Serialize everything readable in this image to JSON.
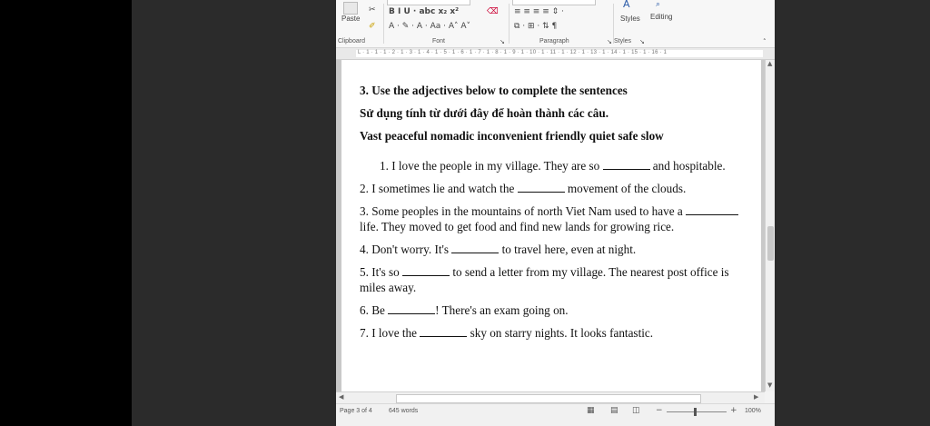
{
  "ribbon": {
    "paste_label": "Paste",
    "styles_label": "Styles",
    "editing_label": "Editing",
    "groups": {
      "clipboard": "Clipboard",
      "font": "Font",
      "paragraph": "Paragraph",
      "styles": "Styles"
    },
    "font_row1": "B  I  U · abc x₂ x²",
    "font_row2": "A · ✎ · A · Aa ·  A˄ A˅",
    "para_row1": "≡ ≡ ≡ ≡   ⇕ ·",
    "para_row2": "⧉ · ⊞ ·  ⇅  ¶"
  },
  "ruler": {
    "marks": "L · 1 · 1 · 1 · 2 · 1 · 3 · 1 · 4 · 1 · 5 · 1 · 6 · 1 · 7 · 1 · 8 · 1 · 9 · 1 · 10 · 1 · 11 · 1 · 12 · 1 · 13 · 1 · 14 · 1 · 15 · 1 · 16 · 1"
  },
  "document": {
    "heading": "3. Use the adjectives below to complete the sentences",
    "heading_vi": "Sử dụng tính từ dưới đây để hoàn thành các câu.",
    "adjectives": "Vast peaceful nomadic inconvenient friendly quiet safe slow",
    "s1_a": "1. I love the people in my village. They are so",
    "s1_b": "and hospitable.",
    "s2_a": "2. I sometimes lie and watch the",
    "s2_b": "movement of the clouds.",
    "s3_a": "3. Some peoples in the mountains of north Viet Nam used to have a",
    "s3_b": "life. They moved to get food and find new lands for growing rice.",
    "s4_a": "4. Don't worry. It's",
    "s4_b": "to travel here, even at night.",
    "s5_a": "5. It's so",
    "s5_b": "to send a letter from my village. The nearest post office is miles away.",
    "s6_a": "6. Be",
    "s6_b": "! There's an exam going on.",
    "s7_a": "7. I love the",
    "s7_b": "sky on starry nights. It looks fantastic."
  },
  "status": {
    "page": "Page 3 of 4",
    "words": "645 words",
    "zoom": "100%"
  }
}
